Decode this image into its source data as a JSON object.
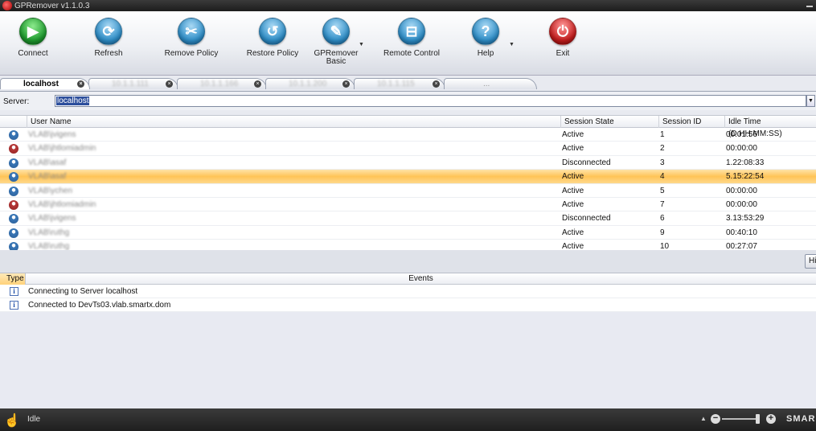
{
  "window": {
    "title": "GPRemover v1.1.0.3"
  },
  "toolbar": {
    "buttons": [
      {
        "label": "Connect",
        "icon": "play-icon",
        "color": "green",
        "glyph": "▶"
      },
      {
        "label": "Refresh",
        "icon": "refresh-icon",
        "color": "blue",
        "glyph": "⟳"
      },
      {
        "label": "Remove Policy",
        "icon": "remove-policy-icon",
        "color": "blue",
        "glyph": "✂"
      },
      {
        "label": "Restore Policy",
        "icon": "restore-icon",
        "color": "blue",
        "glyph": "↺"
      },
      {
        "label": "GPRemover\nBasic",
        "icon": "wrench-icon",
        "color": "blue",
        "glyph": "✎"
      },
      {
        "label": "Remote Control",
        "icon": "gamepad-icon",
        "color": "blue",
        "glyph": "⊟"
      },
      {
        "label": "Help",
        "icon": "help-icon",
        "color": "blue",
        "glyph": "?"
      },
      {
        "label": "Exit",
        "icon": "power-icon",
        "color": "red",
        "glyph": "⏻"
      }
    ]
  },
  "tabs": [
    {
      "label": "localhost",
      "active": true
    },
    {
      "label": "10.1.1.111",
      "active": false
    },
    {
      "label": "10.1.1.166",
      "active": false
    },
    {
      "label": "10.1.1.200",
      "active": false
    },
    {
      "label": "10.1.1.115",
      "active": false
    },
    {
      "label": "...",
      "active": false
    }
  ],
  "server": {
    "label": "Server:",
    "value": "localhost"
  },
  "sessions": {
    "columns": [
      "User Name",
      "Session State",
      "Session ID",
      "Idle Time  (D.HH:MM:SS)"
    ],
    "rows": [
      {
        "user": "VLAB\\jvigens",
        "state": "Active",
        "id": "1",
        "idle": "00:01:56",
        "icon": "blue"
      },
      {
        "user": "VLAB\\jhtlomiadmin",
        "state": "Active",
        "id": "2",
        "idle": "00:00:00",
        "icon": "red"
      },
      {
        "user": "VLAB\\asaf",
        "state": "Disconnected",
        "id": "3",
        "idle": "1.22:08:33",
        "icon": "blue"
      },
      {
        "user": "VLAB\\asaf",
        "state": "Active",
        "id": "4",
        "idle": "5.15:22:54",
        "icon": "blue",
        "selected": true
      },
      {
        "user": "VLAB\\ychen",
        "state": "Active",
        "id": "5",
        "idle": "00:00:00",
        "icon": "blue"
      },
      {
        "user": "VLAB\\jhtlomiadmin",
        "state": "Active",
        "id": "7",
        "idle": "00:00:00",
        "icon": "red"
      },
      {
        "user": "VLAB\\jvigens",
        "state": "Disconnected",
        "id": "6",
        "idle": "3.13:53:29",
        "icon": "blue"
      },
      {
        "user": "VLAB\\ruthg",
        "state": "Active",
        "id": "9",
        "idle": "00:40:10",
        "icon": "blue"
      },
      {
        "user": "VLAB\\ruthg",
        "state": "Active",
        "id": "10",
        "idle": "00:27:07",
        "icon": "blue"
      }
    ]
  },
  "hide_button": "Hi",
  "events": {
    "columns": [
      "Type",
      "Events"
    ],
    "rows": [
      {
        "type": "info",
        "text": "Connecting to Server localhost"
      },
      {
        "type": "info",
        "text": "Connected to DevTs03.vlab.smartx.dom"
      }
    ]
  },
  "status": {
    "text": "Idle",
    "brand": "SMAR"
  }
}
